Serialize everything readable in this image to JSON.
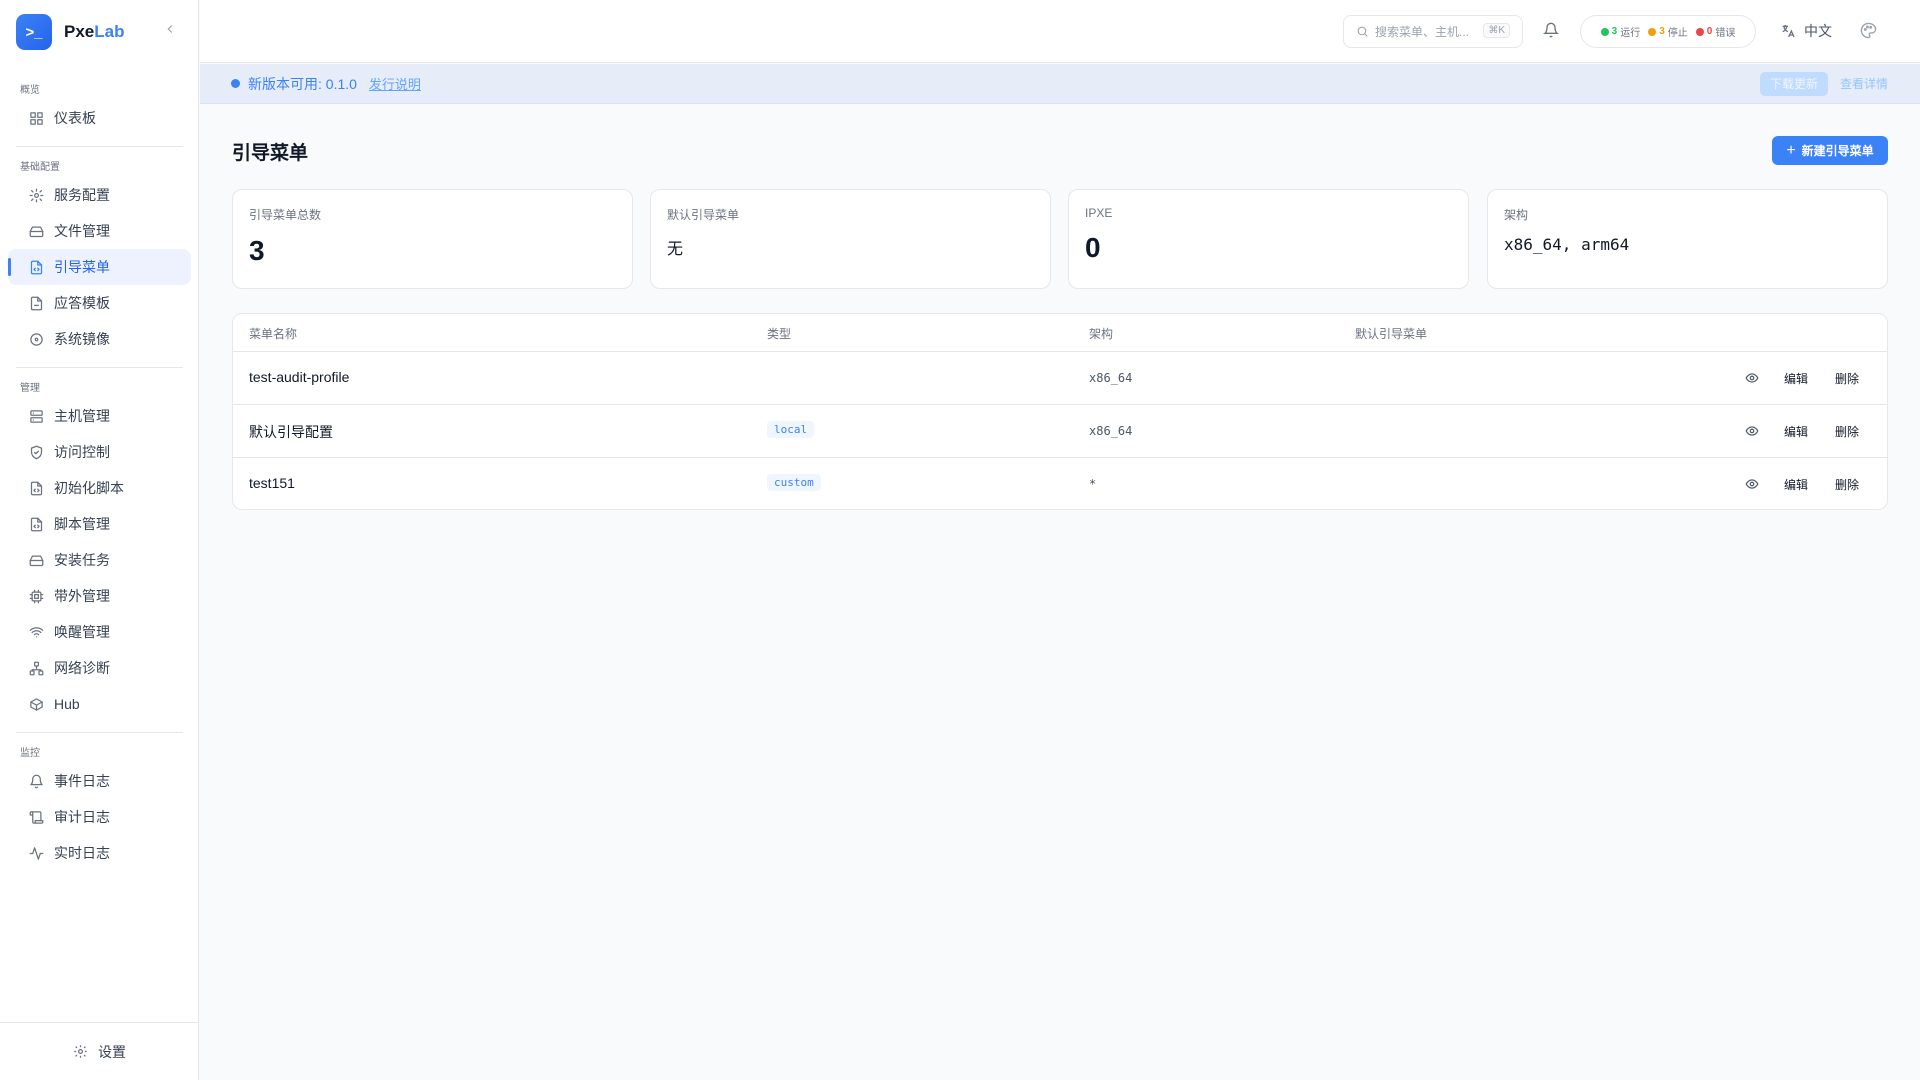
{
  "app": {
    "logo_glyph": ">_",
    "name_part1": "Pxe",
    "name_part2": "Lab",
    "collapse_icon": "chevron-left-icon"
  },
  "sidebar": {
    "sections": [
      {
        "label": "概览",
        "items": [
          {
            "label": "仪表板",
            "icon": "grid-icon"
          }
        ]
      },
      {
        "label": "基础配置",
        "items": [
          {
            "label": "服务配置",
            "icon": "gear-icon"
          },
          {
            "label": "文件管理",
            "icon": "drive-icon"
          },
          {
            "label": "引导菜单",
            "icon": "file-code-icon",
            "active": true
          },
          {
            "label": "应答模板",
            "icon": "file-icon"
          },
          {
            "label": "系统镜像",
            "icon": "disc-icon"
          }
        ]
      },
      {
        "label": "管理",
        "items": [
          {
            "label": "主机管理",
            "icon": "server-icon"
          },
          {
            "label": "访问控制",
            "icon": "shield-icon"
          },
          {
            "label": "初始化脚本",
            "icon": "file-code-icon"
          },
          {
            "label": "脚本管理",
            "icon": "file-code-icon"
          },
          {
            "label": "安装任务",
            "icon": "drive-icon"
          },
          {
            "label": "带外管理",
            "icon": "chip-icon"
          },
          {
            "label": "唤醒管理",
            "icon": "wifi-icon"
          },
          {
            "label": "网络诊断",
            "icon": "network-icon"
          },
          {
            "label": "Hub",
            "icon": "package-icon"
          }
        ]
      },
      {
        "label": "监控",
        "items": [
          {
            "label": "事件日志",
            "icon": "bell-icon"
          },
          {
            "label": "审计日志",
            "icon": "scroll-icon"
          },
          {
            "label": "实时日志",
            "icon": "activity-icon"
          }
        ]
      }
    ],
    "settings_label": "设置"
  },
  "header": {
    "search_placeholder": "搜索菜单、主机...",
    "search_shortcut": "⌘K",
    "status": {
      "running_count": "3",
      "running_label": "运行",
      "running_color": "#22c55e",
      "stopped_count": "3",
      "stopped_label": "停止",
      "stopped_color": "#f59e0b",
      "error_count": "0",
      "error_label": "错误",
      "error_color": "#ef4444"
    },
    "language": "中文"
  },
  "banner": {
    "message": "新版本可用: 0.1.0",
    "notes_link": "发行说明",
    "download_button": "下载更新",
    "details_link": "查看详情"
  },
  "page": {
    "title": "引导菜单",
    "new_button": "新建引导菜单"
  },
  "stats": [
    {
      "label": "引导菜单总数",
      "value": "3",
      "style": "big"
    },
    {
      "label": "默认引导菜单",
      "value": "无",
      "style": "mid"
    },
    {
      "label": "IPXE",
      "value": "0",
      "style": "big"
    },
    {
      "label": "架构",
      "value": "x86_64, arm64",
      "style": "mono"
    }
  ],
  "table": {
    "columns": [
      "菜单名称",
      "类型",
      "架构",
      "默认引导菜单"
    ],
    "rows": [
      {
        "name": "test-audit-profile",
        "type": "",
        "arch": "x86_64",
        "default": ""
      },
      {
        "name": "默认引导配置",
        "type": "local",
        "arch": "x86_64",
        "default": ""
      },
      {
        "name": "test151",
        "type": "custom",
        "arch": "*",
        "default": ""
      }
    ],
    "edit_label": "编辑",
    "delete_label": "删除"
  },
  "accent_color": "#3b82f6"
}
